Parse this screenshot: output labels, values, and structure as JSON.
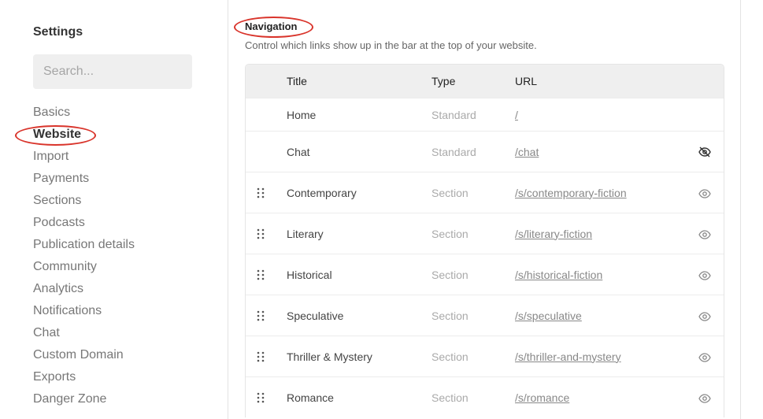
{
  "sidebar": {
    "title": "Settings",
    "search_placeholder": "Search...",
    "items": [
      "Basics",
      "Website",
      "Import",
      "Payments",
      "Sections",
      "Podcasts",
      "Publication details",
      "Community",
      "Analytics",
      "Notifications",
      "Chat",
      "Custom Domain",
      "Exports",
      "Danger Zone"
    ],
    "active": "Website"
  },
  "navigation": {
    "heading": "Navigation",
    "description": "Control which links show up in the bar at the top of your website.",
    "columns": [
      "Title",
      "Type",
      "URL"
    ],
    "rows": [
      {
        "title": "Home",
        "type": "Standard",
        "url": "/",
        "draggable": false,
        "visibility": "none"
      },
      {
        "title": "Chat",
        "type": "Standard",
        "url": "/chat",
        "draggable": false,
        "visibility": "hidden"
      },
      {
        "title": "Contemporary",
        "type": "Section",
        "url": "/s/contemporary-fiction",
        "draggable": true,
        "visibility": "visible"
      },
      {
        "title": "Literary",
        "type": "Section",
        "url": "/s/literary-fiction",
        "draggable": true,
        "visibility": "visible"
      },
      {
        "title": "Historical",
        "type": "Section",
        "url": "/s/historical-fiction",
        "draggable": true,
        "visibility": "visible"
      },
      {
        "title": "Speculative",
        "type": "Section",
        "url": "/s/speculative",
        "draggable": true,
        "visibility": "visible"
      },
      {
        "title": "Thriller & Mystery",
        "type": "Section",
        "url": "/s/thriller-and-mystery",
        "draggable": true,
        "visibility": "visible"
      },
      {
        "title": "Romance",
        "type": "Section",
        "url": "/s/romance",
        "draggable": true,
        "visibility": "visible"
      }
    ]
  },
  "annotation_color": "#d9342b"
}
